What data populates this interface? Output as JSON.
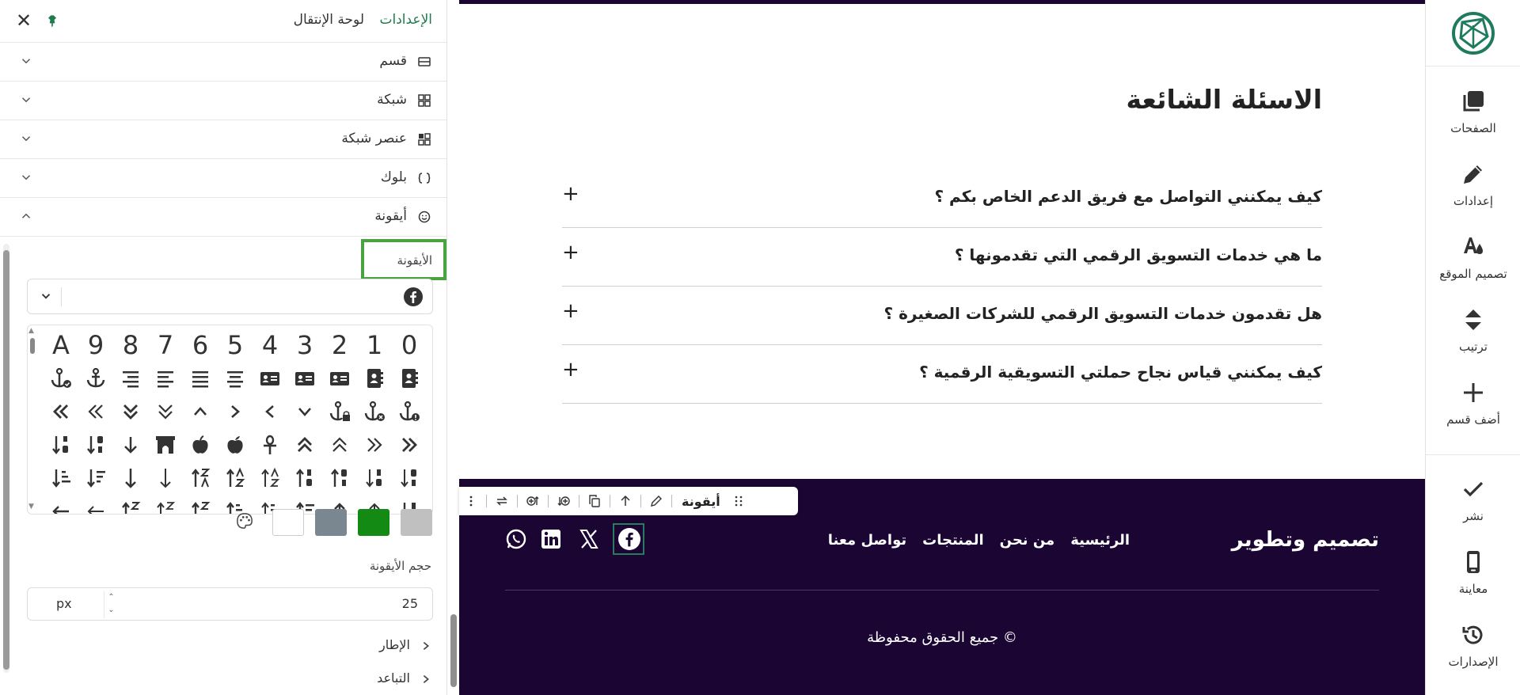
{
  "panel": {
    "tab_settings": "الإعدادات",
    "tab_navigation": "لوحة الإنتقال",
    "accordion": [
      {
        "label": "قسم",
        "icon": "section-icon"
      },
      {
        "label": "شبكة",
        "icon": "grid-icon"
      },
      {
        "label": "عنصر شبكة",
        "icon": "grid-item-icon"
      },
      {
        "label": "بلوك",
        "icon": "block-icon"
      },
      {
        "label": "أيقونة",
        "icon": "smiley-icon"
      }
    ],
    "icon_label": "الأيقونة",
    "icon_select_value": "facebook-icon",
    "icon_grid_row1": [
      "A",
      "9",
      "8",
      "7",
      "6",
      "5",
      "4",
      "3",
      "2",
      "1",
      "0"
    ],
    "colors": [
      "#ffffff",
      "#7a8791",
      "#138a13",
      "#c0c0c0"
    ],
    "size_label": "حجم الأيقونة",
    "size_value": "25",
    "size_unit": "px",
    "border_label": "الإطار",
    "spacing_label": "التباعد"
  },
  "preview": {
    "faq_title": "الاسئلة الشائعة",
    "faq": [
      "كيف يمكنني التواصل مع فريق الدعم الخاص بكم ؟",
      "ما هي خدمات التسويق الرقمي التي تقدمونها ؟",
      "هل تقدمون خدمات التسويق الرقمي للشركات الصغيرة ؟",
      "كيف يمكنني قياس نجاح حملتي التسويقية الرقمية ؟"
    ],
    "faq_toggle": "+",
    "toolbar_label": "أيقونة",
    "footer_brand": "تصميم وتطوير",
    "footer_nav": [
      "الرئيسية",
      "من نحن",
      "المنتجات",
      "تواصل معنا"
    ],
    "footer_copy": "جميع الحقوق محفوظة ©",
    "colors": {
      "footer_bg": "#1b0533",
      "accent": "#1e7b4f"
    }
  },
  "sidebar": {
    "items": [
      {
        "label": "الصفحات",
        "icon": "pages-icon"
      },
      {
        "label": "إعدادات",
        "icon": "pencil-icon"
      },
      {
        "label": "تصميم الموقع",
        "icon": "design-icon"
      },
      {
        "label": "ترتيب",
        "icon": "sort-icon"
      },
      {
        "label": "أضف قسم",
        "icon": "plus-icon"
      },
      {
        "label": "نشر",
        "icon": "check-icon"
      },
      {
        "label": "معاينة",
        "icon": "mobile-icon"
      },
      {
        "label": "الإصدارات",
        "icon": "history-icon"
      }
    ]
  }
}
